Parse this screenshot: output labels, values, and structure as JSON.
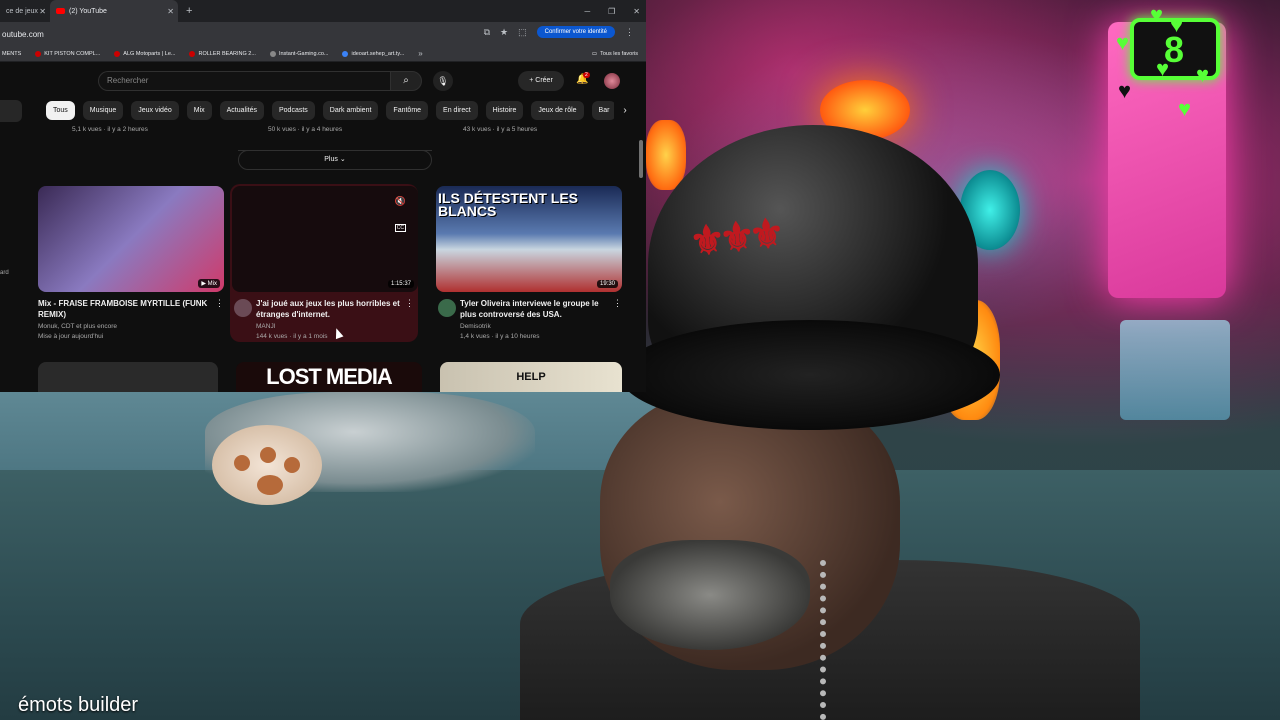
{
  "browser": {
    "tabs": [
      {
        "label": "ce de jeux",
        "active": false
      },
      {
        "label": "(2) YouTube",
        "active": true
      }
    ],
    "url": "outube.com",
    "identity_button": "Confirmer votre identité",
    "bookmarks": [
      "MENTS",
      "KIT PISTON COMPL...",
      "ALG Motoparts | Le...",
      "ROLLER BEARING 2...",
      "Instant-Gaming.co...",
      "ideoart.sehep_art.ty..."
    ],
    "bookmarks_more": "»",
    "bookmarks_all": "Tous les favoris"
  },
  "youtube": {
    "search_placeholder": "Rechercher",
    "create_label": "Créer",
    "notification_count": "2",
    "chips": [
      "Tous",
      "Musique",
      "Jeux vidéo",
      "Mix",
      "Actualités",
      "Podcasts",
      "Dark ambient",
      "Fantôme",
      "En direct",
      "Histoire",
      "Jeux de rôle",
      "Bar"
    ],
    "prev_row": [
      {
        "stats": "5,1 k vues · il y a 2 heures"
      },
      {
        "stats": "50 k vues · il y a 4 heures"
      },
      {
        "stats": "43 k vues · il y a 5 heures"
      }
    ],
    "plus_label": "Plus",
    "videos": [
      {
        "title": "Mix - FRAISE FRAMBOISE MYRTILLE (FUNK REMIX)",
        "channel": "Monuk, CDT et plus encore",
        "stats": "Mise à jour aujourd'hui",
        "badge": "Mix"
      },
      {
        "title": "J'ai joué aux jeux les plus horribles et étranges d'internet.",
        "channel": "MANJI",
        "stats": "144 k vues · il y a 1 mois",
        "badge": "1:15:37"
      },
      {
        "title": "Tyler Oliveira interviewe le groupe le plus controversé des USA.",
        "channel": "Demisotrik",
        "stats": "1,4 k vues · il y a 10 heures",
        "badge": "19:30",
        "thumb_text": "ILS DÉTESTENT LES BLANCS"
      }
    ],
    "bottom_thumbs": [
      "LOST MEDIA",
      "HELP"
    ],
    "left_clip": "ard"
  },
  "overlay": {
    "caption": "émots builder",
    "alert_text": "8"
  }
}
